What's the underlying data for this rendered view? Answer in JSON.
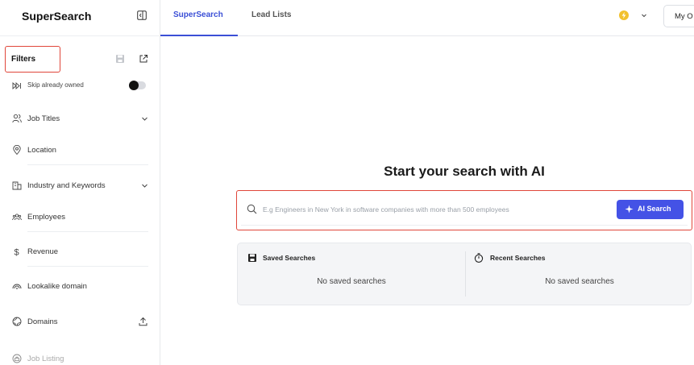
{
  "app": {
    "brand": "SuperSearch"
  },
  "sidebar": {
    "filters_title": "Filters",
    "skip_label": "Skip already owned",
    "skip_enabled": false,
    "items": [
      {
        "label": "Job Titles",
        "icon": "people-icon",
        "chevron": true
      },
      {
        "label": "Location",
        "icon": "location-pin-icon"
      },
      {
        "label": "Industry and Keywords",
        "icon": "building-icon",
        "chevron": true
      },
      {
        "label": "Employees",
        "icon": "team-icon"
      },
      {
        "label": "Revenue",
        "icon": "dollar-icon"
      },
      {
        "label": "Lookalike domain",
        "icon": "lookalike-icon"
      },
      {
        "label": "Domains",
        "icon": "globe-icon",
        "upload": true
      },
      {
        "label": "Job Listing",
        "icon": "job-icon"
      }
    ]
  },
  "topbar": {
    "tabs": [
      {
        "label": "SuperSearch",
        "active": true
      },
      {
        "label": "Lead Lists",
        "active": false
      }
    ],
    "org_label": "My O"
  },
  "main": {
    "hero_title": "Start your search with AI",
    "search": {
      "placeholder": "E.g Engineers in New York in software companies with more than 500 employees",
      "value": "",
      "button_label": "AI Search"
    },
    "saved_searches": {
      "title": "Saved Searches",
      "empty": "No saved searches"
    },
    "recent_searches": {
      "title": "Recent Searches",
      "empty": "No saved searches"
    }
  },
  "colors": {
    "accent": "#4452e6",
    "tab_active": "#3b4fd6",
    "highlight_border": "#e0463a"
  }
}
